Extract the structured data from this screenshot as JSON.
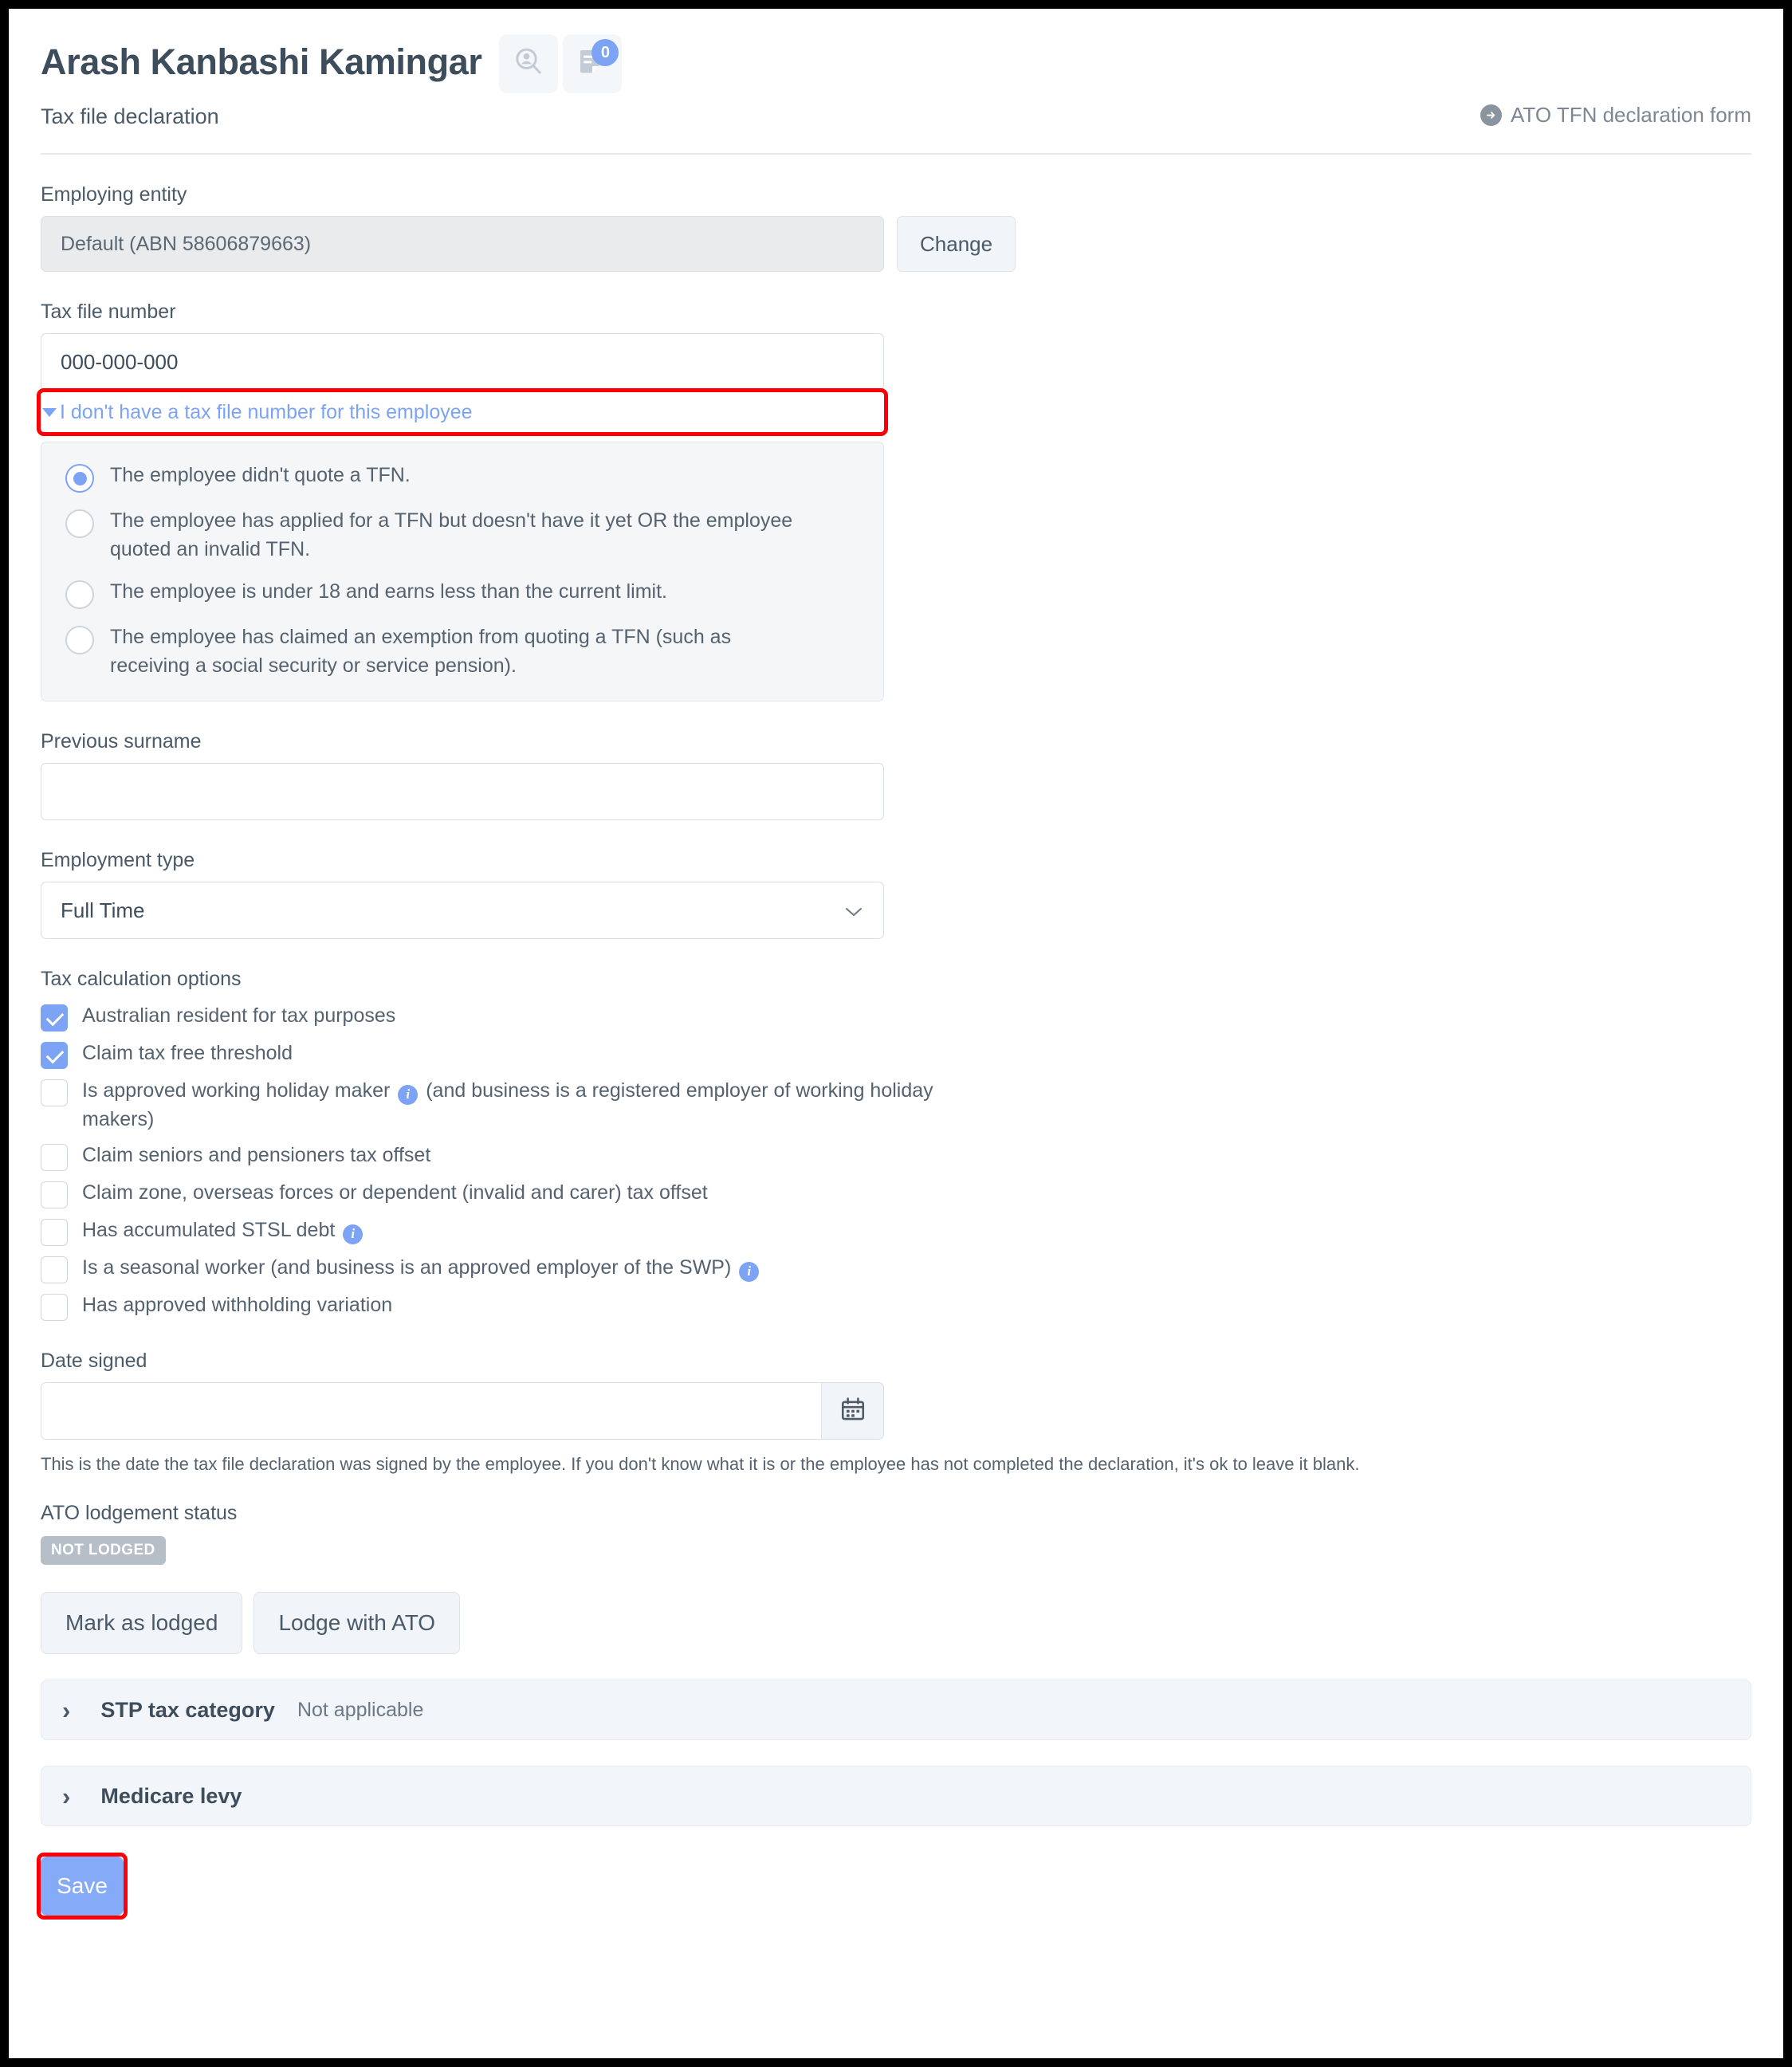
{
  "header": {
    "employee_name": "Arash Kanbashi Kamingar",
    "subtitle": "Tax file declaration",
    "icons": {
      "person_search": "person-search-icon",
      "notes": "notes-document-icon",
      "notes_badge": "0"
    },
    "ato_form_link": "ATO TFN declaration form"
  },
  "employing_entity": {
    "label": "Employing entity",
    "value": "Default (ABN 58606879663)",
    "change_label": "Change"
  },
  "tax_file_number": {
    "label": "Tax file number",
    "value": "000-000-000",
    "no_tfn_link": "I don't have a tax file number for this employee",
    "options": [
      {
        "label": "The employee didn't quote a TFN.",
        "checked": true
      },
      {
        "label": "The employee has applied for a TFN but doesn't have it yet OR the employee quoted an invalid TFN.",
        "checked": false
      },
      {
        "label": "The employee is under 18 and earns less than the current limit.",
        "checked": false
      },
      {
        "label": "The employee has claimed an exemption from quoting a TFN (such as receiving a social security or service pension).",
        "checked": false
      }
    ]
  },
  "previous_surname": {
    "label": "Previous surname",
    "value": ""
  },
  "employment_type": {
    "label": "Employment type",
    "value": "Full Time"
  },
  "tax_calculation_options": {
    "label": "Tax calculation options",
    "items": [
      {
        "label": "Australian resident for tax purposes",
        "checked": true,
        "info": false
      },
      {
        "label": "Claim tax free threshold",
        "checked": true,
        "info": false
      },
      {
        "label_before": "Is approved working holiday maker",
        "label_after": "(and business is a registered employer of working holiday makers)",
        "checked": false,
        "info": true
      },
      {
        "label": "Claim seniors and pensioners tax offset",
        "checked": false,
        "info": false
      },
      {
        "label": "Claim zone, overseas forces or dependent (invalid and carer) tax offset",
        "checked": false,
        "info": false
      },
      {
        "label_before": "Has accumulated STSL debt",
        "label_after": "",
        "checked": false,
        "info": true
      },
      {
        "label_before": "Is a seasonal worker (and business is an approved employer of the SWP)",
        "label_after": "",
        "checked": false,
        "info": true
      },
      {
        "label": "Has approved withholding variation",
        "checked": false,
        "info": false
      }
    ]
  },
  "date_signed": {
    "label": "Date signed",
    "value": "",
    "calendar_icon": "calendar-icon",
    "help": "This is the date the tax file declaration was signed by the employee. If you don't know what it is or the employee has not completed the declaration, it's ok to leave it blank."
  },
  "ato_lodgement": {
    "label": "ATO lodgement status",
    "status": "NOT LODGED",
    "mark_as_lodged": "Mark as lodged",
    "lodge_with_ato": "Lodge with ATO"
  },
  "accordions": [
    {
      "title": "STP tax category",
      "value": "Not applicable"
    },
    {
      "title": "Medicare levy",
      "value": ""
    }
  ],
  "save_label": "Save",
  "colors": {
    "accent_blue": "#7da3f5",
    "save_blue": "#85aaf7",
    "annotation_red": "#fb0007",
    "badge_grey": "#b6bec7",
    "text_dark": "#3d4d5c",
    "text_mid": "#55626f",
    "panel_grey": "#f5f6f8",
    "accordion_bg": "#f2f5f9"
  }
}
